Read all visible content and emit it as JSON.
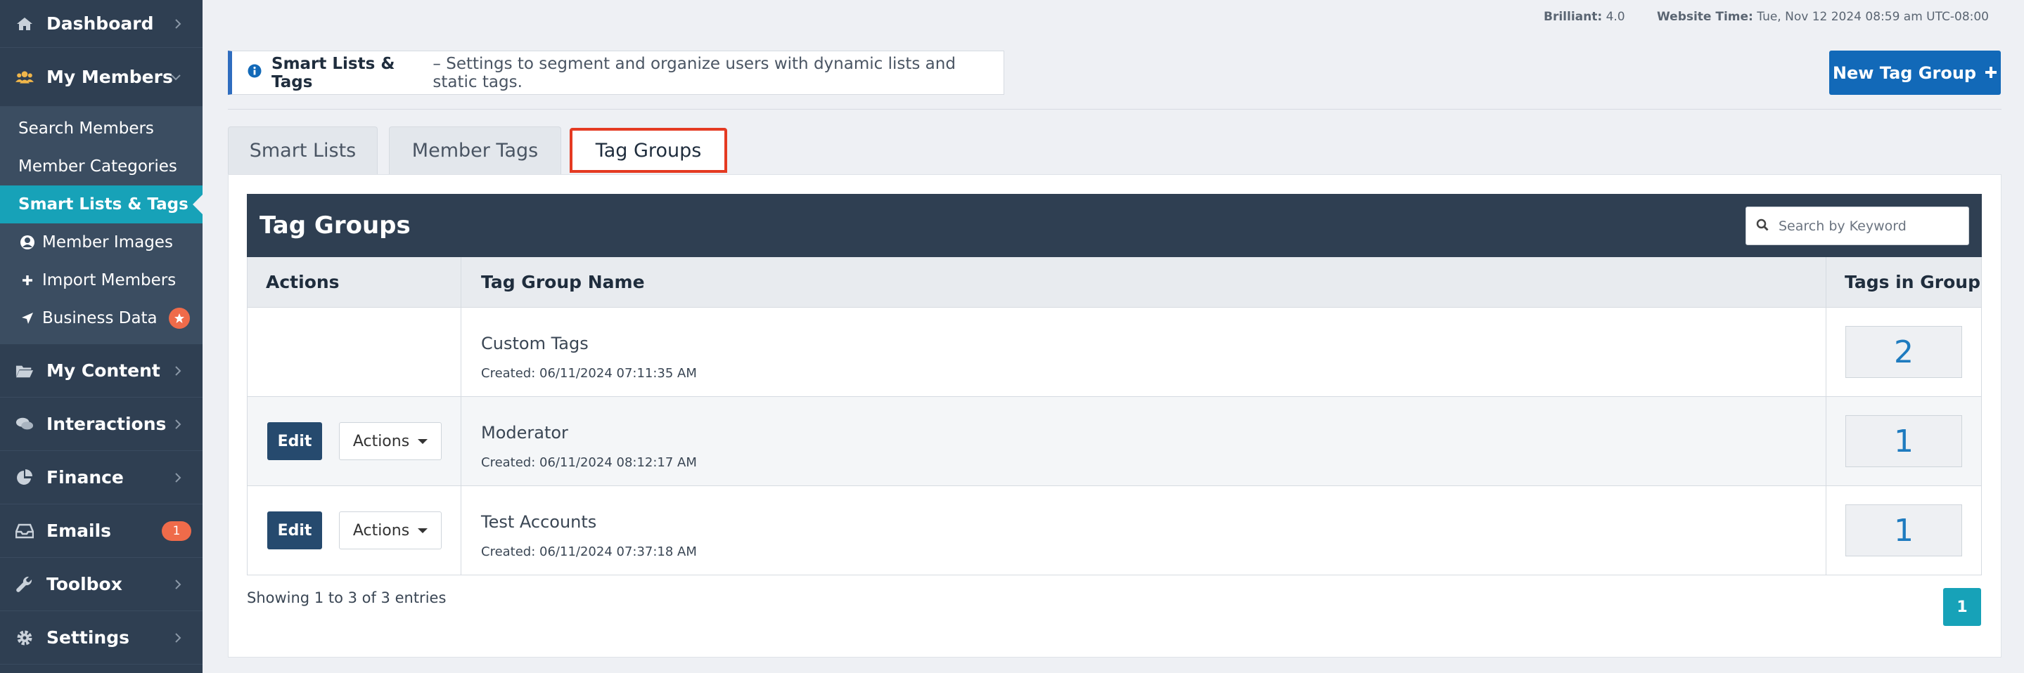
{
  "sidebar": {
    "dashboard": "Dashboard",
    "my_members": "My Members",
    "sub_items": [
      {
        "label": "Search Members"
      },
      {
        "label": "Member Categories"
      },
      {
        "label": "Smart Lists & Tags"
      },
      {
        "label": "Member Images"
      },
      {
        "label": "Import Members"
      },
      {
        "label": "Business Data"
      }
    ],
    "my_content": "My Content",
    "interactions": "Interactions",
    "finance": "Finance",
    "emails": "Emails",
    "emails_badge": "1",
    "toolbox": "Toolbox",
    "settings": "Settings"
  },
  "top_info": {
    "brilliant_label": "Brilliant:",
    "brilliant_value": "4.0",
    "time_label": "Website Time:",
    "time_value": "Tue, Nov 12 2024 08:59 am UTC-08:00"
  },
  "infobar": {
    "title": "Smart Lists & Tags",
    "text": "– Settings to segment and organize users with dynamic lists and static tags."
  },
  "new_button": "New Tag Group",
  "tabs": [
    {
      "label": "Smart Lists"
    },
    {
      "label": "Member Tags"
    },
    {
      "label": "Tag Groups"
    }
  ],
  "table": {
    "title": "Tag Groups",
    "search_placeholder": "Search by Keyword",
    "columns": [
      "Actions",
      "Tag Group Name",
      "Tags in Group"
    ],
    "edit_label": "Edit",
    "actions_label": "Actions",
    "rows": [
      {
        "name": "Custom Tags",
        "created": "Created: 06/11/2024 07:11:35 AM",
        "count": "2"
      },
      {
        "name": "Moderator",
        "created": "Created: 06/11/2024 08:12:17 AM",
        "count": "1"
      },
      {
        "name": "Test Accounts",
        "created": "Created: 06/11/2024 07:37:18 AM",
        "count": "1"
      }
    ],
    "showing": "Showing 1 to 3 of 3 entries",
    "page": "1"
  },
  "colors": {
    "sidebar_bg": "#2f3f52",
    "accent_teal": "#17a2b8",
    "primary_blue": "#1269b8",
    "highlight_red": "#e43a22",
    "badge_orange": "#ef6b4a"
  }
}
